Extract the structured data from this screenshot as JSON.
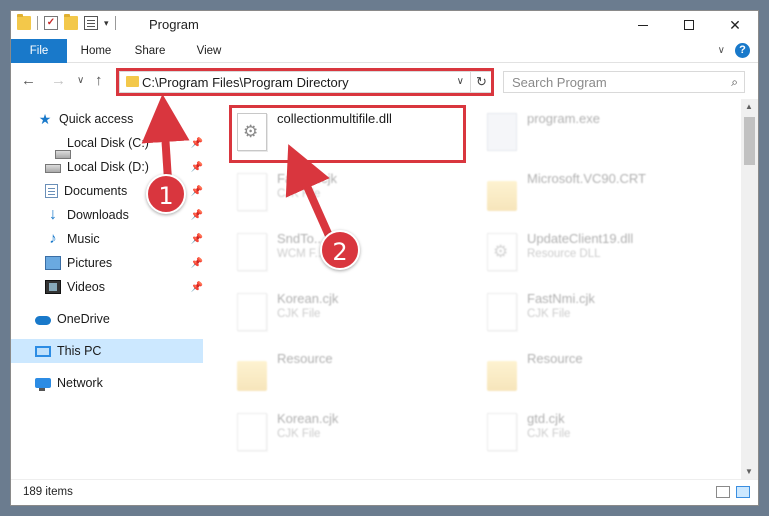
{
  "window": {
    "title": "Program",
    "minimize_glyph": "—",
    "close_glyph": "✕"
  },
  "ribbon": {
    "tabs": [
      "File",
      "Home",
      "Share",
      "View"
    ],
    "expand_glyph": "∨",
    "help_glyph": "?"
  },
  "nav": {
    "back_glyph": "←",
    "forward_glyph": "→",
    "recent_glyph": "∨",
    "up_glyph": "↑"
  },
  "address": {
    "path": "C:\\Program Files\\Program Directory",
    "dropdown_glyph": "∨",
    "refresh_glyph": "↻"
  },
  "search": {
    "placeholder": "Search Program",
    "icon_glyph": "⌕"
  },
  "sidebar": {
    "items": [
      {
        "label": "Quick access",
        "icon": "star-icon"
      },
      {
        "label": "Local Disk (C:)",
        "icon": "drive-icon",
        "pinned": true
      },
      {
        "label": "Local Disk (D:)",
        "icon": "drive-icon",
        "pinned": true
      },
      {
        "label": "Documents",
        "icon": "documents-icon",
        "pinned": true
      },
      {
        "label": "Downloads",
        "icon": "download-icon",
        "pinned": true
      },
      {
        "label": "Music",
        "icon": "music-icon",
        "pinned": true
      },
      {
        "label": "Pictures",
        "icon": "pictures-icon",
        "pinned": true
      },
      {
        "label": "Videos",
        "icon": "video-icon",
        "pinned": true
      },
      {
        "label": "OneDrive",
        "icon": "cloud-icon"
      },
      {
        "label": "This PC",
        "icon": "computer-icon",
        "selected": true
      },
      {
        "label": "Network",
        "icon": "network-icon"
      }
    ],
    "pin_glyph": "📌"
  },
  "files": [
    {
      "name": "collectionmultifile.dll",
      "type": "",
      "icon": "dll-gear-icon",
      "highlighted": true
    },
    {
      "name": "program.exe",
      "type": "",
      "icon": "exe-icon"
    },
    {
      "name": "Fa...on.cjk",
      "type": "CJK File",
      "icon": "file-icon"
    },
    {
      "name": "Microsoft.VC90.CRT",
      "type": "",
      "icon": "folder-icon"
    },
    {
      "name": "SndTo...ecm",
      "type": "WCM F...",
      "icon": "file-icon"
    },
    {
      "name": "UpdateClient19.dll",
      "type": "Resource DLL",
      "icon": "dll-gear-icon"
    },
    {
      "name": "Korean.cjk",
      "type": "CJK File",
      "icon": "file-icon"
    },
    {
      "name": "FastNmi.cjk",
      "type": "CJK File",
      "icon": "file-icon"
    },
    {
      "name": "Resource",
      "type": "",
      "icon": "folder-icon"
    },
    {
      "name": "Resource",
      "type": "",
      "icon": "folder-icon"
    },
    {
      "name": "Korean.cjk",
      "type": "CJK File",
      "icon": "file-icon"
    },
    {
      "name": "gtd.cjk",
      "type": "CJK File",
      "icon": "file-icon"
    }
  ],
  "status": {
    "item_count": "189 items"
  },
  "annotations": {
    "step1": "1",
    "step2": "2",
    "color": "#d9363e"
  }
}
